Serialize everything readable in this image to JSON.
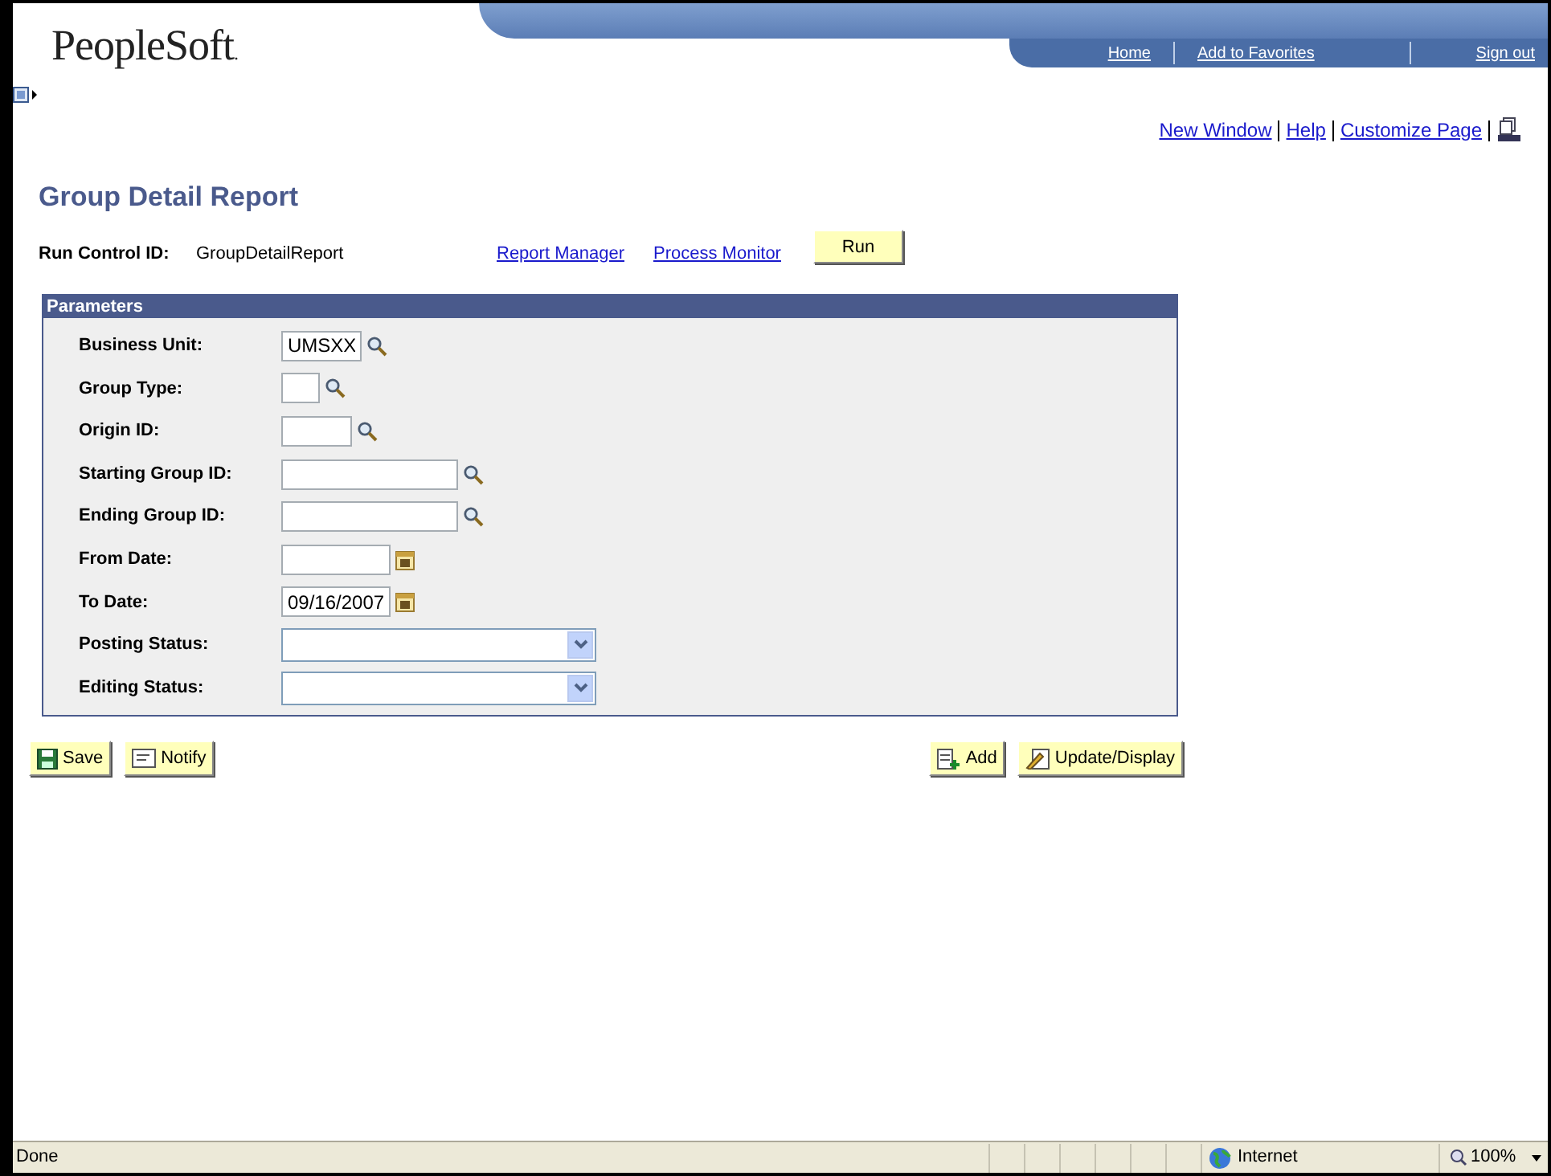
{
  "header": {
    "logo": "PeopleSoft",
    "logo_mark": ".",
    "nav": [
      "Home",
      "Add to Favorites",
      "Sign out"
    ]
  },
  "toolbar_links": [
    "New Window",
    "Help",
    "Customize Page"
  ],
  "page": {
    "title": "Group Detail Report",
    "run_control_label": "Run Control ID:",
    "run_control_value": "GroupDetailReport",
    "links": [
      "Report Manager",
      "Process Monitor"
    ],
    "run_button": "Run"
  },
  "parameters": {
    "title": "Parameters",
    "fields": [
      {
        "label": "Business Unit:",
        "kind": "lookup",
        "value": "UMSXX"
      },
      {
        "label": "Group Type:",
        "kind": "lookup"
      },
      {
        "label": "Origin ID:",
        "kind": "lookup"
      },
      {
        "label": "Starting Group ID:",
        "kind": "lookup"
      },
      {
        "label": "Ending Group ID:",
        "kind": "lookup"
      },
      {
        "label": "From Date:",
        "kind": "date"
      },
      {
        "label": "To Date:",
        "kind": "date",
        "value": "09/16/2007"
      },
      {
        "label": "Posting Status:",
        "kind": "dropdown"
      },
      {
        "label": "Editing Status:",
        "kind": "dropdown"
      }
    ]
  },
  "left_buttons": [
    "Save",
    "Notify"
  ],
  "right_buttons": [
    "Add",
    "Update/Display"
  ],
  "status_bar": {
    "text": "Done",
    "zone": "Internet",
    "zoom": "100%"
  }
}
